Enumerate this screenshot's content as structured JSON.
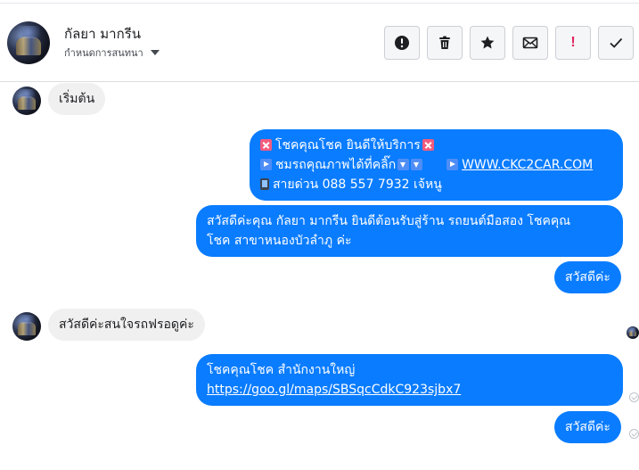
{
  "header": {
    "contact_name": "กัลยา มากรีน",
    "assign_label": "กำหนดการสนทนา",
    "actions": [
      {
        "name": "report-spam",
        "icon": "alert-circle-icon"
      },
      {
        "name": "delete",
        "icon": "trash-icon"
      },
      {
        "name": "star",
        "icon": "star-icon"
      },
      {
        "name": "mark-unread",
        "icon": "envelope-icon"
      },
      {
        "name": "follow-up",
        "icon": "exclamation-icon",
        "glyph": "!"
      },
      {
        "name": "mark-done",
        "icon": "checkmark-icon"
      }
    ]
  },
  "messages": [
    {
      "from": "customer",
      "text": "เริ่มต้น"
    },
    {
      "from": "page",
      "line1": "โชคคุณโชค ยินดีให้บริการ",
      "line2_text": "ชมรถคุณภาพได้ที่คลิ๊ก",
      "line2_link": "WWW.CKC2CAR.COM",
      "line3": "สายด่วน 088 557 7932 เจ้หนู"
    },
    {
      "from": "page",
      "line1": "สวัสดีค่ะคุณ กัลยา มากรีน ยินดีต้อนรับสู่ร้าน รถยนต์มือสอง โชคคุณ",
      "line2": "โชค สาขาหนองบัวลำภู ค่ะ"
    },
    {
      "from": "page",
      "text": "สวัสดีค่ะ"
    },
    {
      "from": "customer",
      "text": "สวัสดีค่ะสนใจรถฟรอดูค่ะ"
    },
    {
      "from": "page",
      "line1": "โชคคุณโชค สำนักงานใหญ่",
      "link": "https://goo.gl/maps/SBSqcCdkC923sjbx7"
    },
    {
      "from": "page",
      "text": "สวัสดีค่ะ"
    }
  ],
  "colors": {
    "outgoing_bubble": "#0a7cff",
    "incoming_bubble": "#f1f0f0",
    "follow_up_red": "#e0245e"
  }
}
